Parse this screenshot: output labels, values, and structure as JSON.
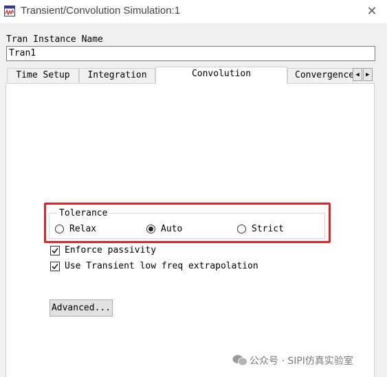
{
  "window": {
    "title": "Transient/Convolution Simulation:1",
    "close_glyph": "✕",
    "app_icon": "simulation-waveform-icon"
  },
  "instance": {
    "label": "Tran Instance Name",
    "value": "Tran1"
  },
  "tabs": [
    {
      "label": "Time Setup",
      "active": false
    },
    {
      "label": "Integration",
      "active": false
    },
    {
      "label": "Convolution",
      "active": true
    },
    {
      "label": "Convergence",
      "active": false
    }
  ],
  "tab_scroll": {
    "left": "◀",
    "right": "▶"
  },
  "tolerance": {
    "label": "Tolerance",
    "options": [
      {
        "label": "Relax",
        "selected": false
      },
      {
        "label": "Auto",
        "selected": true
      },
      {
        "label": "Strict",
        "selected": false
      }
    ]
  },
  "options": {
    "enforce_passivity": {
      "label": "Enforce passivity",
      "checked": true
    },
    "low_freq_extrapolation": {
      "label": "Use Transient low freq extrapolation",
      "checked": true
    }
  },
  "advanced_button": "Advanced...",
  "watermark": "公众号 · SIPI仿真实验室",
  "colors": {
    "highlight": "#d8262e",
    "watermark": "#7a7a7a"
  }
}
